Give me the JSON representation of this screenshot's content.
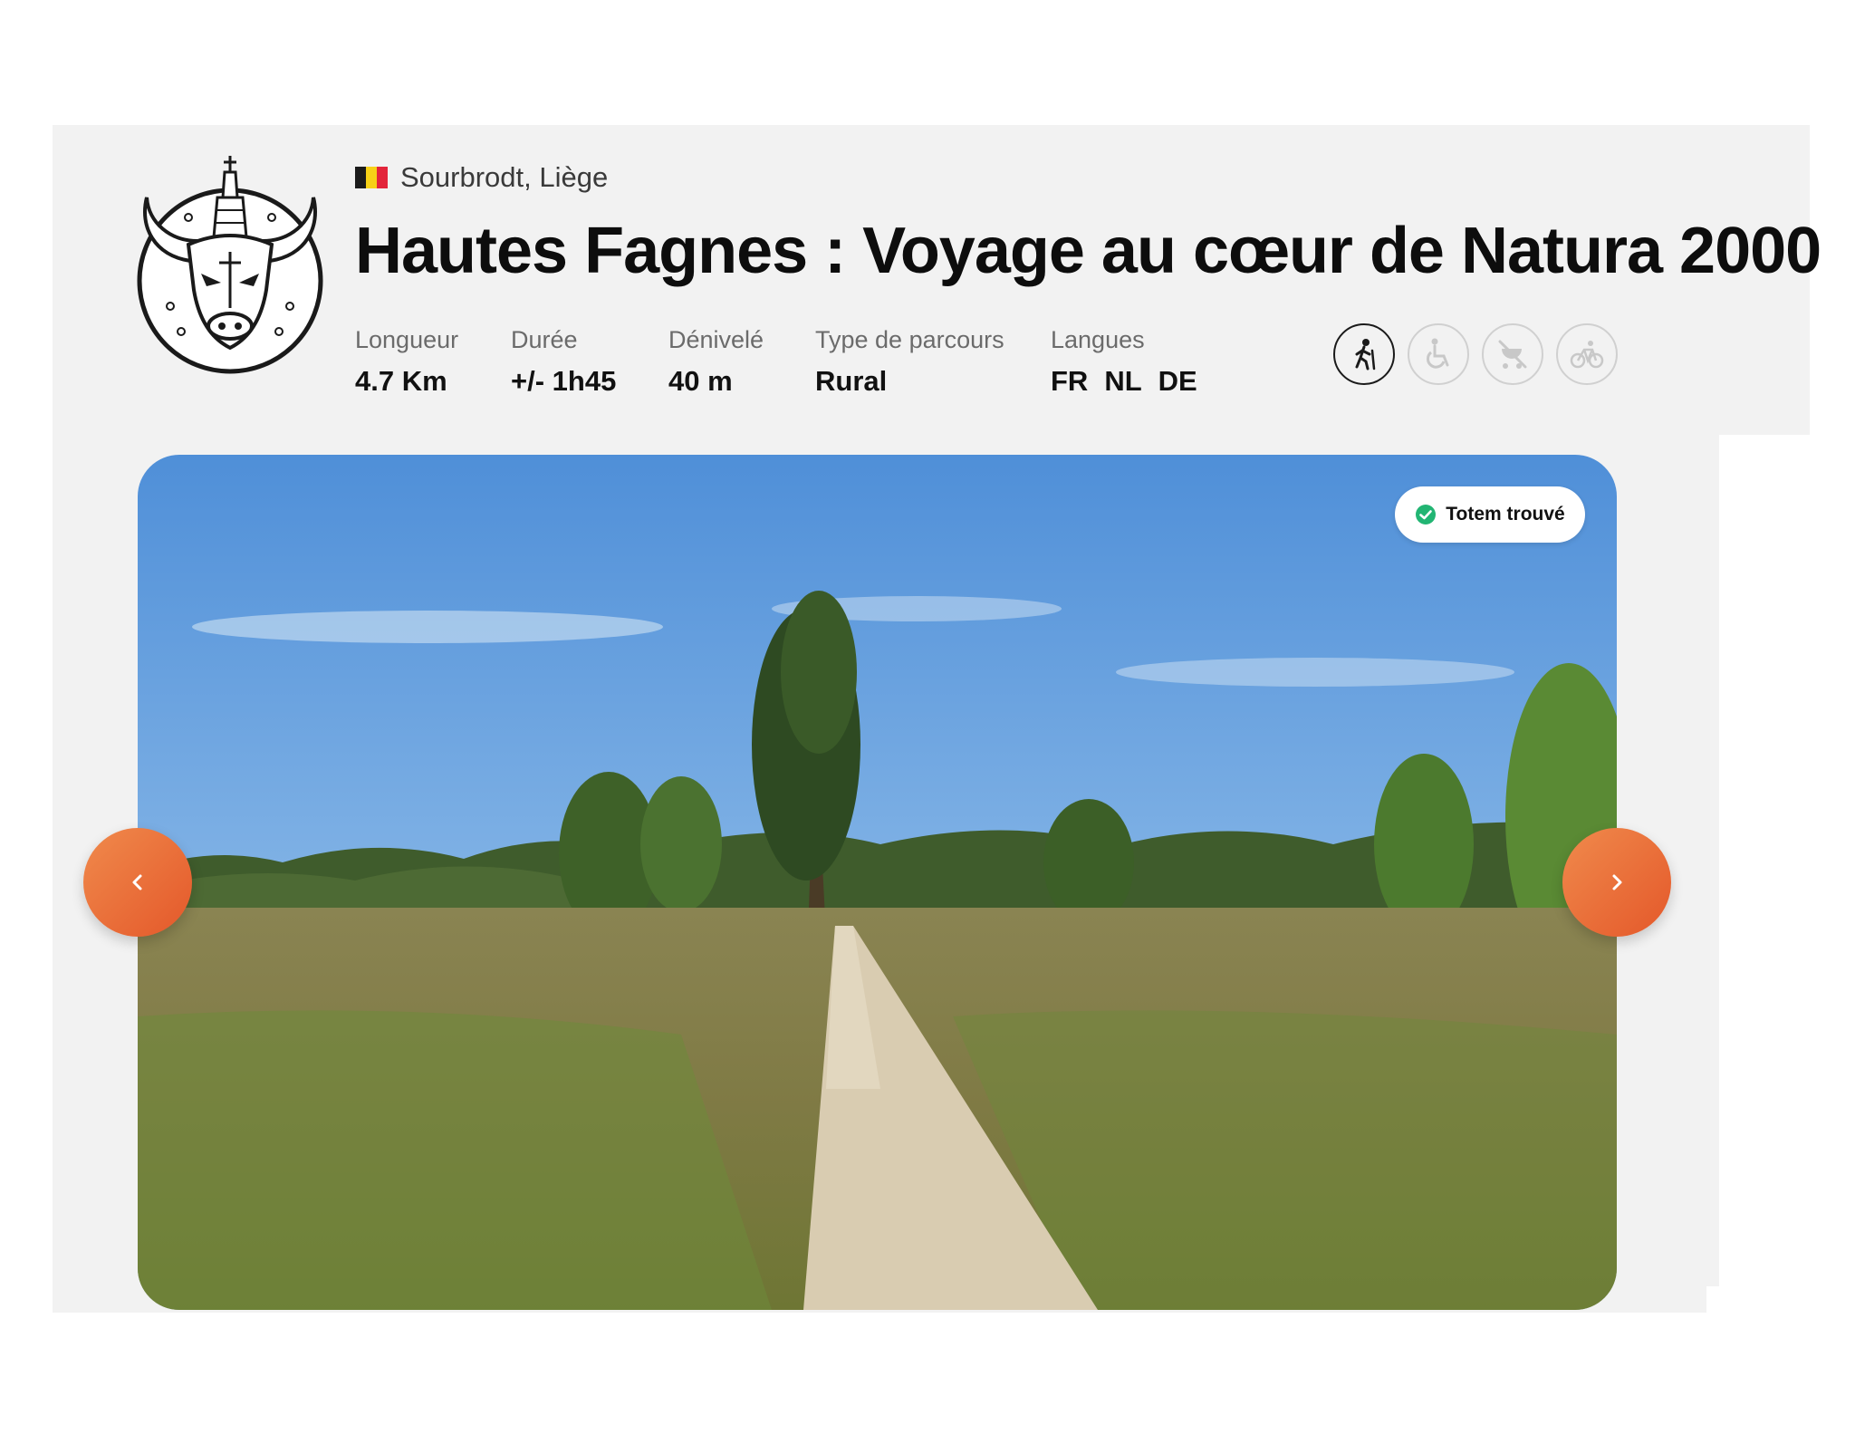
{
  "header": {
    "location": "Sourbrodt, Liège",
    "country_flag_colors": [
      "#1b1b1b",
      "#f7d117",
      "#e3253b"
    ],
    "title": "Hautes Fagnes : Voyage au cœur de Natura 2000",
    "emblem_icon": "bull-head-emblem-icon"
  },
  "stats": [
    {
      "label": "Longueur",
      "value": "4.7 Km"
    },
    {
      "label": "Durée",
      "value": "+/- 1h45"
    },
    {
      "label": "Dénivelé",
      "value": "40 m"
    },
    {
      "label": "Type de parcours",
      "value": "Rural"
    }
  ],
  "languages": {
    "label": "Langues",
    "items": [
      "FR",
      "NL",
      "DE"
    ]
  },
  "activities": [
    {
      "icon": "hiker-icon",
      "active": true
    },
    {
      "icon": "wheelchair-icon",
      "active": false
    },
    {
      "icon": "stroller-icon",
      "active": false
    },
    {
      "icon": "bicycle-icon",
      "active": false
    }
  ],
  "gallery": {
    "badge": "Totem trouvé",
    "badge_color": "#22b573",
    "prev_icon": "chevron-left-icon",
    "next_icon": "chevron-right-icon",
    "accent": "#ec6d35"
  }
}
